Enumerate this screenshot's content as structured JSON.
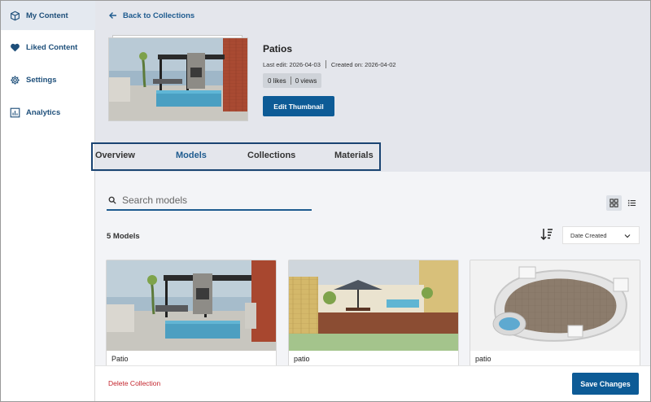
{
  "sidebar": {
    "items": [
      {
        "label": "My Content",
        "icon": "cube-icon",
        "active": true
      },
      {
        "label": "Liked Content",
        "icon": "heart-icon",
        "active": false
      },
      {
        "label": "Settings",
        "icon": "gear-icon",
        "active": false
      },
      {
        "label": "Analytics",
        "icon": "bar-chart-icon",
        "active": false
      }
    ]
  },
  "header": {
    "back_label": "Back to Collections",
    "title": "Patios",
    "last_edit": "Last edit: 2026-04-03",
    "created_on": "Created on: 2026-04-02",
    "likes": "0 likes",
    "views": "0 views",
    "edit_thumbnail_label": "Edit Thumbnail"
  },
  "tabs": [
    {
      "label": "Overview",
      "active": false
    },
    {
      "label": "Models",
      "active": true
    },
    {
      "label": "Collections",
      "active": false
    },
    {
      "label": "Materials",
      "active": false
    }
  ],
  "content": {
    "search_placeholder": "Search models",
    "count_label": "5 Models",
    "sort_value": "Date Created",
    "cards": [
      {
        "name": "Patio"
      },
      {
        "name": "patio"
      },
      {
        "name": "patio"
      }
    ]
  },
  "footer": {
    "delete_label": "Delete Collection",
    "save_label": "Save Changes"
  },
  "colors": {
    "accent": "#0d5b96",
    "link": "#1e5b8f",
    "danger": "#c4262e",
    "header_bg": "#e4e6ec",
    "content_bg": "#f3f4f7"
  }
}
